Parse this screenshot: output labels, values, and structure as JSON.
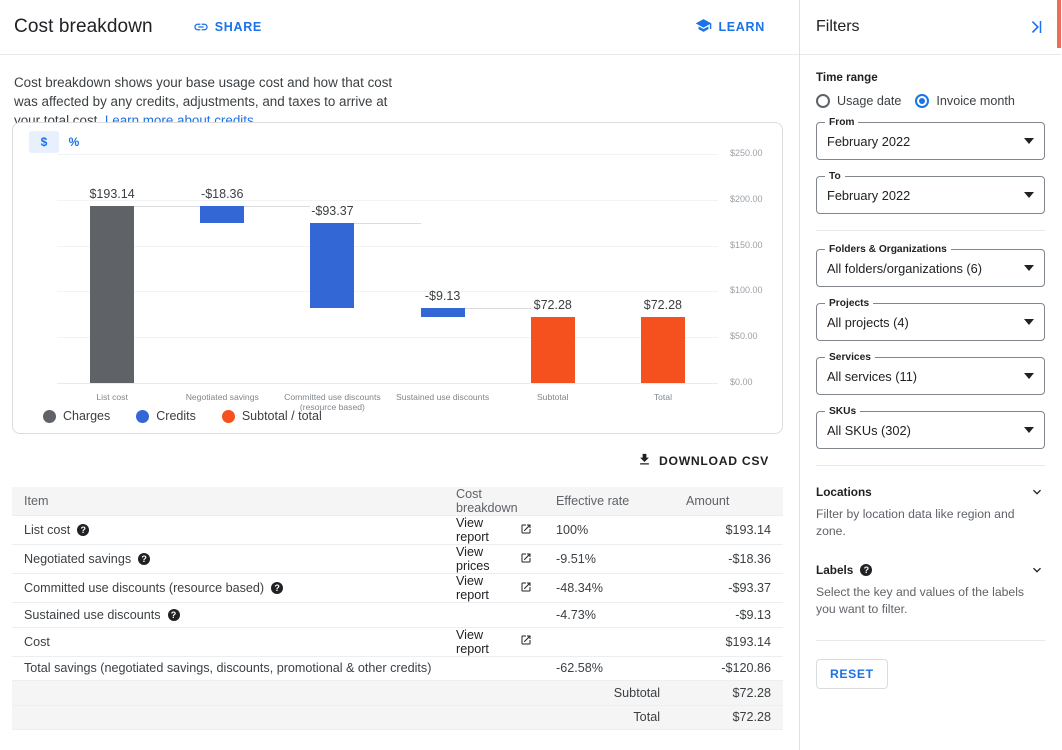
{
  "header": {
    "title": "Cost breakdown",
    "share_label": "SHARE",
    "share_icon": "link-icon",
    "learn_label": "LEARN",
    "learn_icon": "school-icon"
  },
  "description": {
    "text": "Cost breakdown shows your base usage cost and how that cost was affected by any credits, adjustments, and taxes to arrive at your total cost. ",
    "link_text": "Learn more about credits"
  },
  "unit_toggle": {
    "currency_label": "$",
    "percent_label": "%",
    "selected": "$"
  },
  "chart_data": {
    "type": "bar",
    "title": "",
    "xlabel": "",
    "ylabel": "",
    "ylim": [
      0,
      250
    ],
    "grid": true,
    "tick_labels": [
      "$0.00",
      "$50.00",
      "$100.00",
      "$150.00",
      "$200.00",
      "$250.00"
    ],
    "tick_values": [
      0,
      50,
      100,
      150,
      200,
      250
    ],
    "categories": [
      "List cost",
      "Negotiated savings",
      "Committed use discounts (resource based)",
      "Sustained use discounts",
      "Subtotal",
      "Total"
    ],
    "values": [
      193.14,
      -18.36,
      -93.37,
      -9.13,
      72.28,
      72.28
    ],
    "value_labels": [
      "$193.14",
      "-$18.36",
      "-$93.37",
      "-$9.13",
      "$72.28",
      "$72.28"
    ],
    "bar_kinds": [
      "charges",
      "credits",
      "credits",
      "credits",
      "subtotal",
      "subtotal"
    ],
    "waterfall_tops": [
      193.14,
      193.14,
      174.78,
      81.41,
      72.28,
      72.28
    ],
    "waterfall_bottoms": [
      0,
      174.78,
      81.41,
      72.28,
      0,
      0
    ],
    "colors": {
      "charges": "#5f6368",
      "credits": "#3367d6",
      "subtotal": "#f4511e"
    },
    "legend_position": "bottom-left",
    "legend": [
      {
        "label": "Charges",
        "color": "#5f6368"
      },
      {
        "label": "Credits",
        "color": "#3367d6"
      },
      {
        "label": "Subtotal / total",
        "color": "#f4511e"
      }
    ]
  },
  "download": {
    "label": "DOWNLOAD CSV",
    "icon": "download-icon"
  },
  "table": {
    "columns": [
      "Item",
      "Cost breakdown",
      "Effective rate",
      "Amount"
    ],
    "rows": [
      {
        "item": "List cost",
        "has_help": true,
        "link": "View report",
        "rate": "100%",
        "amount": "$193.14",
        "shade": false
      },
      {
        "item": "Negotiated savings",
        "has_help": true,
        "link": "View prices",
        "rate": "-9.51%",
        "amount": "-$18.36",
        "shade": false
      },
      {
        "item": "Committed use discounts (resource based)",
        "has_help": true,
        "link": "View report",
        "rate": "-48.34%",
        "amount": "-$93.37",
        "shade": false
      },
      {
        "item": "Sustained use discounts",
        "has_help": true,
        "link": "",
        "rate": "-4.73%",
        "amount": "-$9.13",
        "shade": false
      },
      {
        "item": "Cost",
        "has_help": false,
        "link": "View report",
        "rate": "",
        "amount": "$193.14",
        "shade": false
      },
      {
        "item": "Total savings (negotiated savings, discounts, promotional & other credits)",
        "has_help": false,
        "link": "",
        "rate": "-62.58%",
        "amount": "-$120.86",
        "shade": false
      }
    ],
    "summary": [
      {
        "label": "Subtotal",
        "amount": "$72.28"
      },
      {
        "label": "Total",
        "amount": "$72.28"
      }
    ]
  },
  "filters": {
    "title": "Filters",
    "collapse_icon": "collapse-right-icon",
    "time_range_label": "Time range",
    "radios": [
      {
        "label": "Usage date",
        "selected": false
      },
      {
        "label": "Invoice month",
        "selected": true
      }
    ],
    "fields": [
      {
        "legend": "From",
        "value": "February 2022"
      },
      {
        "legend": "To",
        "value": "February 2022"
      }
    ],
    "selects": [
      {
        "legend": "Folders & Organizations",
        "value": "All folders/organizations (6)"
      },
      {
        "legend": "Projects",
        "value": "All projects (4)"
      },
      {
        "legend": "Services",
        "value": "All services (11)"
      },
      {
        "legend": "SKUs",
        "value": "All SKUs (302)"
      }
    ],
    "accordions": [
      {
        "title": "Locations",
        "has_help": false,
        "desc": "Filter by location data like region and zone."
      },
      {
        "title": "Labels",
        "has_help": true,
        "desc": "Select the key and values of the labels you want to filter."
      }
    ],
    "reset_label": "RESET"
  }
}
